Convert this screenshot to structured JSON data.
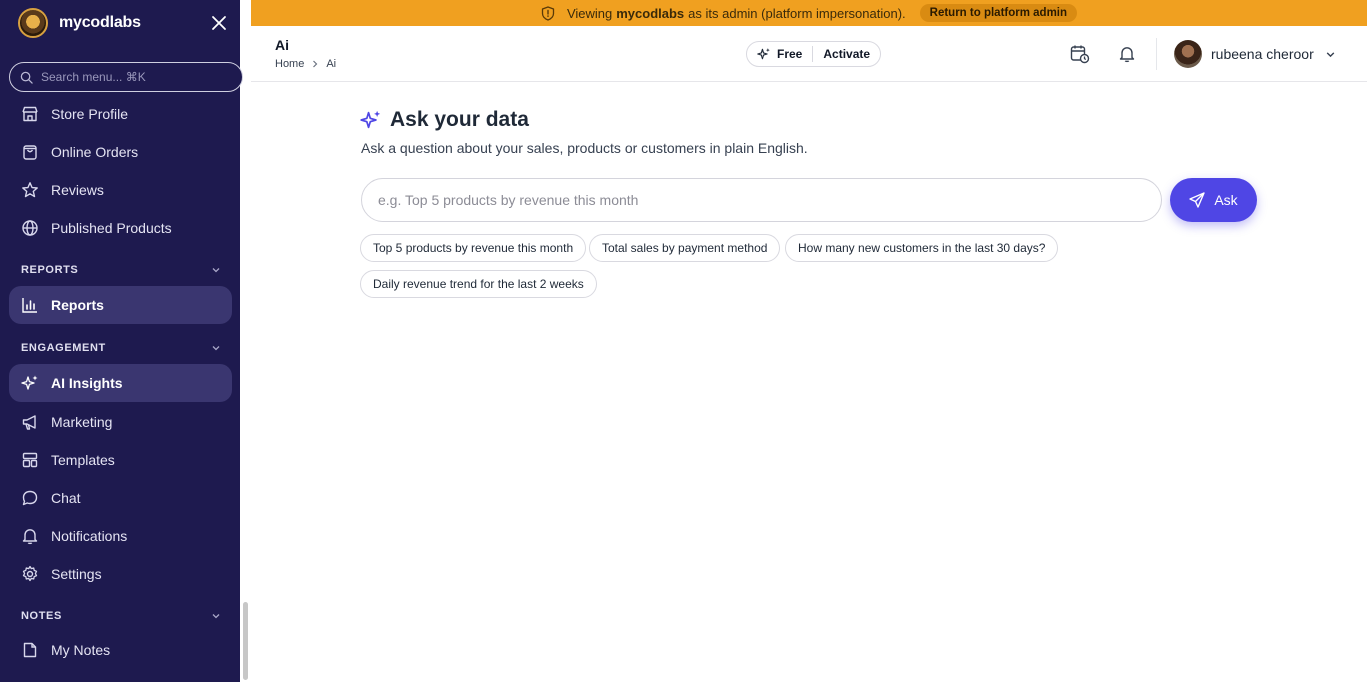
{
  "sidebar": {
    "brand": "mycodlabs",
    "search_placeholder": "Search menu... ⌘K",
    "items_top": [
      {
        "label": "Store Profile",
        "icon": "store-icon"
      },
      {
        "label": "Online Orders",
        "icon": "shopping-bag-icon"
      },
      {
        "label": "Reviews",
        "icon": "star-icon"
      },
      {
        "label": "Published Products",
        "icon": "globe-icon"
      }
    ],
    "sections": {
      "reports": {
        "title": "REPORTS",
        "items": [
          {
            "label": "Reports",
            "icon": "bar-chart-icon",
            "active": true
          }
        ]
      },
      "engagement": {
        "title": "ENGAGEMENT",
        "items": [
          {
            "label": "AI Insights",
            "icon": "sparkles-icon",
            "active": true
          },
          {
            "label": "Marketing",
            "icon": "megaphone-icon"
          },
          {
            "label": "Templates",
            "icon": "layout-icon"
          },
          {
            "label": "Chat",
            "icon": "chat-bubble-icon"
          },
          {
            "label": "Notifications",
            "icon": "bell-icon"
          },
          {
            "label": "Settings",
            "icon": "gear-icon"
          }
        ]
      },
      "notes": {
        "title": "NOTES",
        "items": [
          {
            "label": "My Notes",
            "icon": "note-icon"
          }
        ]
      }
    }
  },
  "banner": {
    "prefix": "Viewing",
    "brand": "mycodlabs",
    "suffix": "as its admin (platform impersonation).",
    "return_label": "Return to platform admin",
    "color": "#f0a020"
  },
  "header": {
    "title": "Ai",
    "breadcrumb": [
      "Home",
      "Ai"
    ],
    "plan": {
      "label": "Free",
      "action": "Activate"
    },
    "user_name": "rubeena cheroor"
  },
  "main": {
    "title": "Ask your data",
    "subtitle": "Ask a question about your sales, products or customers in plain English.",
    "input_placeholder": "e.g. Top 5 products by revenue this month",
    "ask_label": "Ask",
    "suggestions": [
      "Top 5 products by revenue this month",
      "Total sales by payment method",
      "How many new customers in the last 30 days?",
      "Daily revenue trend for the last 2 weeks"
    ]
  },
  "colors": {
    "sidebar_bg": "#1e1a4f",
    "accent": "#4f46e5",
    "active_item_bg": "#3a3670"
  }
}
